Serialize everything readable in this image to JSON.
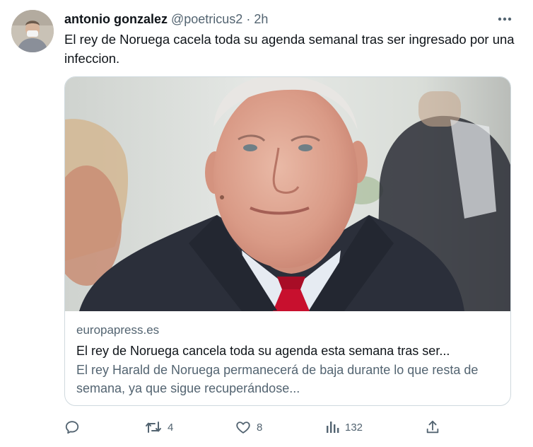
{
  "tweet": {
    "author": {
      "display_name": "antonio gonzalez",
      "handle": "@poetricus2",
      "separator": "·",
      "timestamp": "2h"
    },
    "text": "El rey de Noruega cacela toda su agenda semanal tras ser ingresado por una infeccion.",
    "card": {
      "domain": "europapress.es",
      "title": "El rey de Noruega cancela toda su agenda esta semana tras ser...",
      "description": "El rey Harald de Noruega permanecerá de baja durante lo que resta de semana, ya que sigue recuperándose..."
    },
    "actions": {
      "reply_icon": "reply-icon",
      "retweet_icon": "retweet-icon",
      "retweet_count": "4",
      "like_icon": "heart-icon",
      "like_count": "8",
      "views_icon": "analytics-icon",
      "views_count": "132",
      "share_icon": "share-icon"
    },
    "colors": {
      "text_primary": "#0f1419",
      "text_secondary": "#536471",
      "border": "#cfd9de",
      "tie": "#c8102e"
    }
  }
}
